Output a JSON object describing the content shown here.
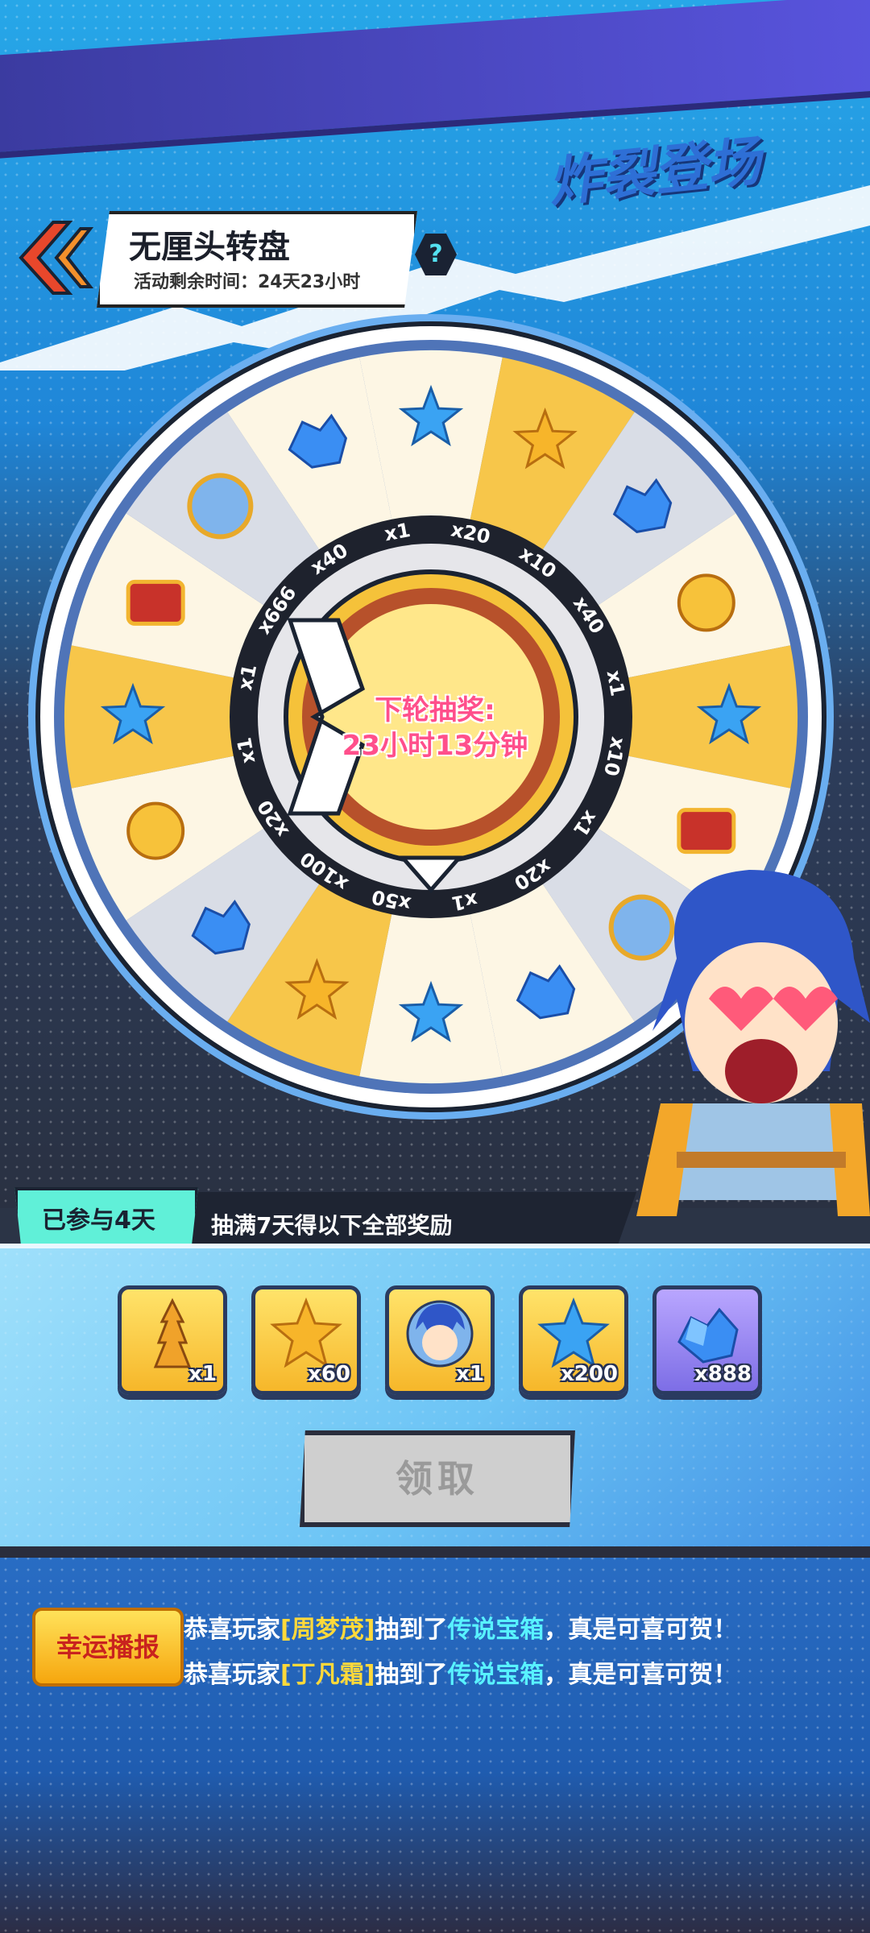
{
  "header": {
    "title": "无厘头转盘",
    "remaining": "活动剩余时间：24天23小时",
    "help_label": "?",
    "logo_text": "炸裂登场"
  },
  "wheel": {
    "multipliers": [
      "x1",
      "x20",
      "x10",
      "x40",
      "x1",
      "x10",
      "x1",
      "x20",
      "x1",
      "x50",
      "x100",
      "x20",
      "x1",
      "x1",
      "x666",
      "x40"
    ],
    "center_line1": "下轮抽奖:",
    "center_line2": "23小时13分钟"
  },
  "participation": {
    "days_label": "已参与4天",
    "hint": "抽满7天得以下全部奖励"
  },
  "rewards": [
    {
      "qty": "x1",
      "icon": "tower-icon"
    },
    {
      "qty": "x60",
      "icon": "gold-star-icon"
    },
    {
      "qty": "x1",
      "icon": "hero-portrait-icon"
    },
    {
      "qty": "x200",
      "icon": "blue-star-icon"
    },
    {
      "qty": "x888",
      "icon": "blue-crystal-icon"
    }
  ],
  "claim_label": "领取",
  "broadcast": {
    "badge": "幸运播报",
    "messages": [
      {
        "prefix": "恭喜玩家",
        "name": "[周梦茂]",
        "mid": "抽到了",
        "item": "传说宝箱",
        "suffix": "，真是可喜可贺！"
      },
      {
        "prefix": "恭喜玩家",
        "name": "[丁凡霜]",
        "mid": "抽到了",
        "item": "传说宝箱",
        "suffix": "，真是可喜可贺！"
      }
    ]
  },
  "colors": {
    "accent_cyan": "#60f0d8",
    "gold": "#f6b72a",
    "pink": "#ff4f8b",
    "broadcast_item": "#58f2ff"
  }
}
